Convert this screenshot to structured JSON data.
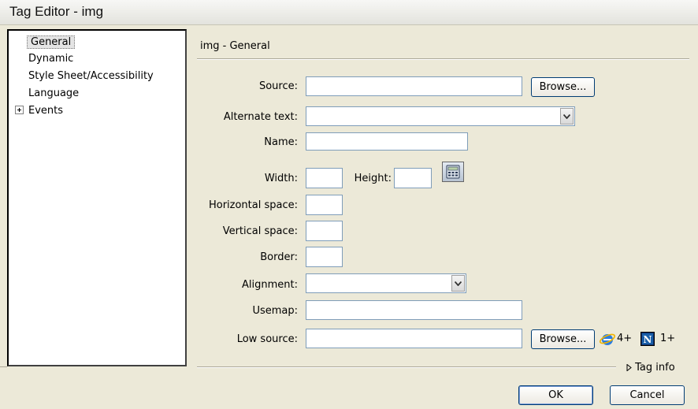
{
  "window": {
    "title": "Tag Editor - img"
  },
  "tree": {
    "items": [
      {
        "label": "General",
        "selected": true
      },
      {
        "label": "Dynamic"
      },
      {
        "label": "Style Sheet/Accessibility"
      },
      {
        "label": "Language"
      },
      {
        "label": "Events",
        "expandable": true
      }
    ]
  },
  "panel": {
    "title": "img - General",
    "fields": {
      "source": {
        "label": "Source:",
        "value": ""
      },
      "alt": {
        "label": "Alternate text:",
        "value": ""
      },
      "name": {
        "label": "Name:",
        "value": ""
      },
      "width": {
        "label": "Width:",
        "value": ""
      },
      "height": {
        "label": "Height:",
        "value": ""
      },
      "hspace": {
        "label": "Horizontal space:",
        "value": ""
      },
      "vspace": {
        "label": "Vertical space:",
        "value": ""
      },
      "border": {
        "label": "Border:",
        "value": ""
      },
      "alignment": {
        "label": "Alignment:",
        "value": ""
      },
      "usemap": {
        "label": "Usemap:",
        "value": ""
      },
      "lowsrc": {
        "label": "Low source:",
        "value": ""
      }
    },
    "browse_label": "Browse...",
    "browser_support": {
      "ie": "4+",
      "netscape": "1+"
    }
  },
  "footer": {
    "tag_info": "Tag info",
    "ok_label": "OK",
    "cancel_label": "Cancel"
  }
}
